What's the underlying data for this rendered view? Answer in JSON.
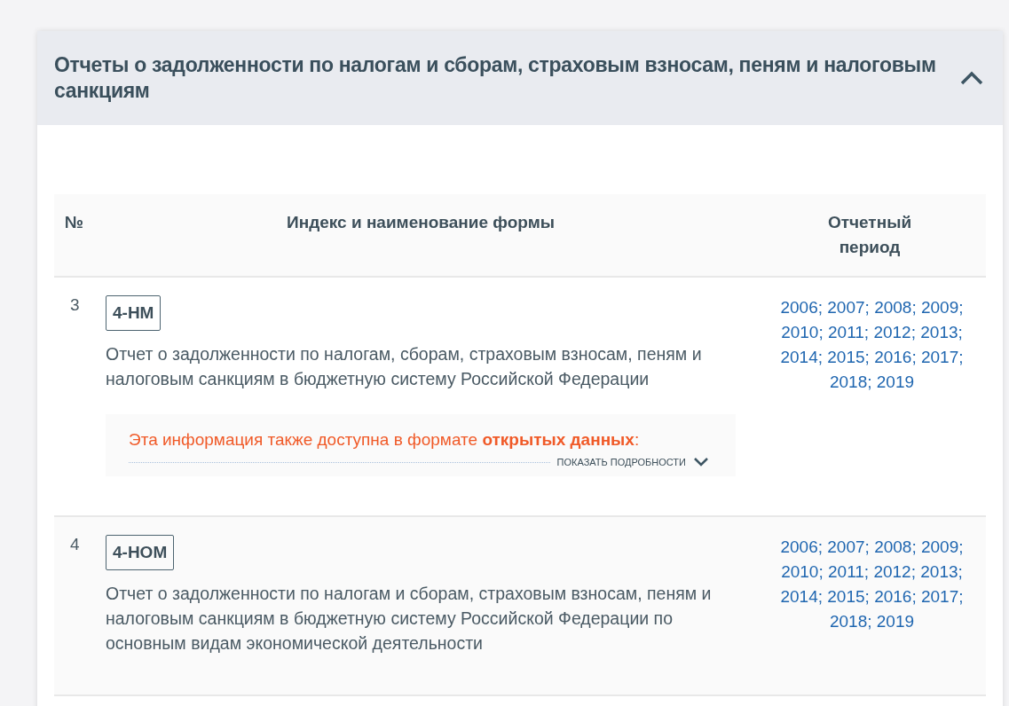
{
  "panel": {
    "title": "Отчеты о задолженности по налогам и сборам, страховым взносам, пеням и налоговым санкциям",
    "expanded": true
  },
  "table": {
    "columns": [
      "№",
      "Индекс и наименование формы",
      "Отчетный период"
    ],
    "years_separator": ";",
    "rows": [
      {
        "number": "3",
        "form_code": "4-НМ",
        "description": "Отчет о задолженности по налогам, сборам, страховым взносам, пеням и налоговым санкциям в бюджетную систему Российской Федерации",
        "highlighted": false,
        "open_data": {
          "text": "Эта информация также доступна в формате **открытых данных**:",
          "details_link": "ПОКАЗАТЬ ПОДРОБНОСТИ",
          "expanded": false
        },
        "years": [
          "2006",
          "2007",
          "2008",
          "2009",
          "2010",
          "2011",
          "2012",
          "2013",
          "2014",
          "2015",
          "2016",
          "2017",
          "2018",
          "2019"
        ]
      },
      {
        "number": "4",
        "form_code": "4-НОМ",
        "description": "Отчет о задолженности по налогам и сборам, страховым взносам, пеням и налоговым санкциям в бюджетную систему Российской Федерации по основным видам экономической деятельности",
        "highlighted": true,
        "years": [
          "2006",
          "2007",
          "2008",
          "2009",
          "2010",
          "2011",
          "2012",
          "2013",
          "2014",
          "2015",
          "2016",
          "2017",
          "2018",
          "2019"
        ]
      }
    ]
  }
}
